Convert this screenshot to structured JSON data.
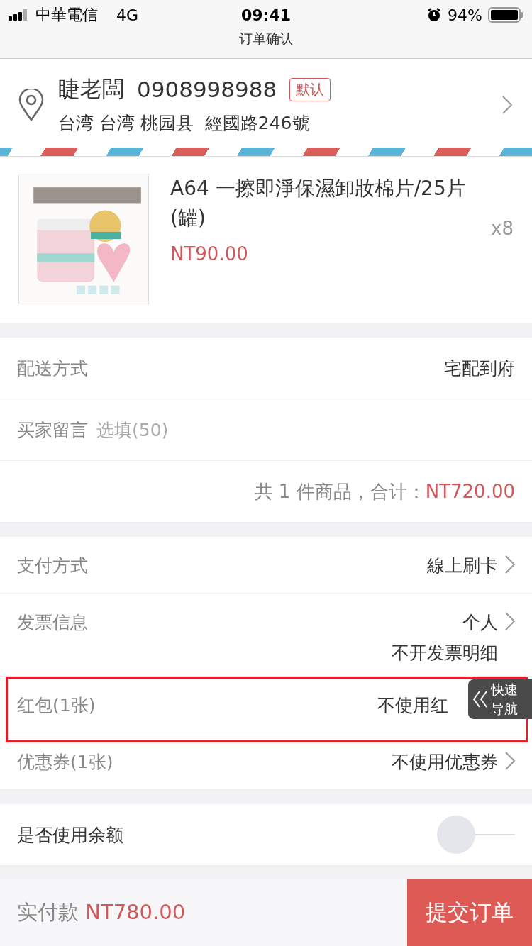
{
  "status_bar": {
    "carrier": "中華電信",
    "network": "4G",
    "time": "09:41",
    "battery": "94%"
  },
  "nav": {
    "title": "订单确认"
  },
  "address": {
    "name": "睫老闆",
    "phone": "0908998988",
    "tag": "默认",
    "line": "台湾 台湾 桃园县  經國路246號"
  },
  "product": {
    "title": "A64 一擦即淨保濕卸妝棉片/25片(罐)",
    "price": "NT90.00",
    "quantity": "x8"
  },
  "order_rows": [
    {
      "kind": "value",
      "label": "配送方式",
      "value": "宅配到府"
    },
    {
      "kind": "input",
      "label": "买家留言",
      "placeholder": "选填(50)"
    }
  ],
  "summary": {
    "text": "共 1 件商品，合计：",
    "amount": "NT720.00"
  },
  "option_rows": [
    {
      "label": "支付方式",
      "values": [
        "線上刷卡"
      ],
      "chevron": true,
      "highlighted": false
    },
    {
      "label": "发票信息",
      "values": [
        "个人",
        "不开发票明细"
      ],
      "chevron": true,
      "highlighted": false
    },
    {
      "label": "红包(1张)",
      "values": [
        "不使用红"
      ],
      "chevron": false,
      "highlighted": true
    },
    {
      "label": "优惠券(1张)",
      "values": [
        "不使用优惠券"
      ],
      "chevron": true,
      "highlighted": false
    }
  ],
  "quick_nav": {
    "label": "快速导航"
  },
  "balance": {
    "label": "是否使用余额",
    "on": false
  },
  "footer": {
    "label": "实付款",
    "amount": "NT780.00",
    "submit": "提交订单"
  }
}
